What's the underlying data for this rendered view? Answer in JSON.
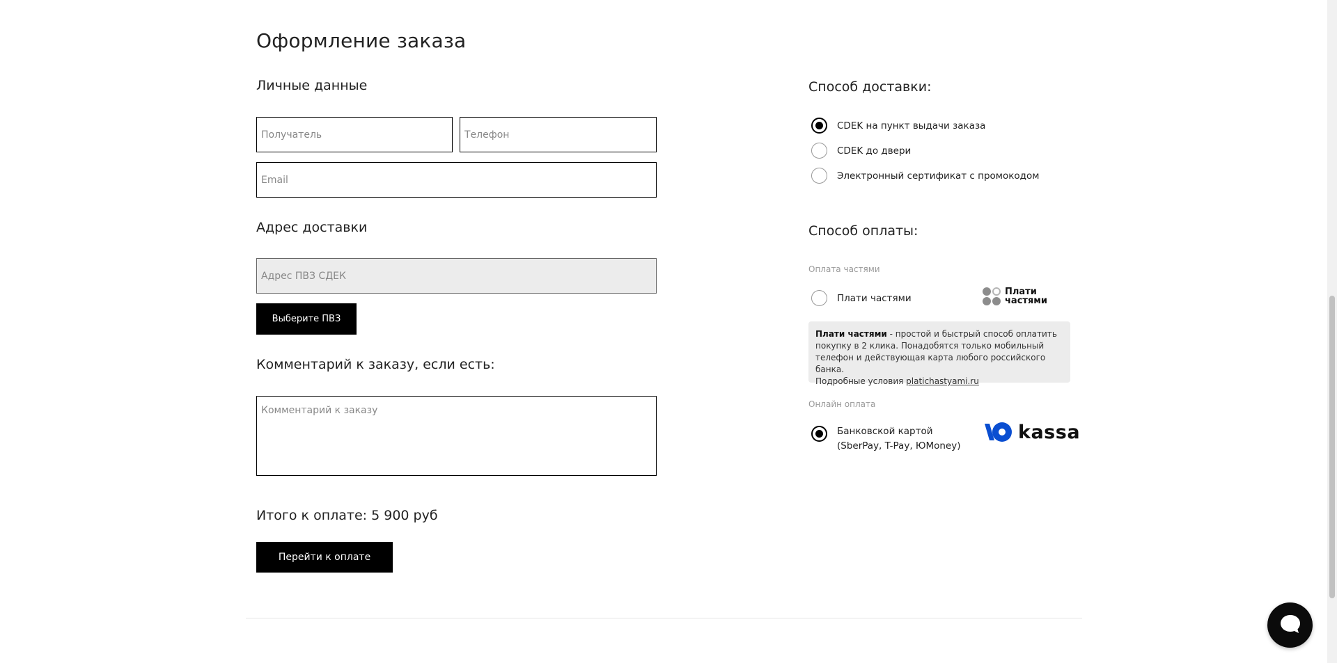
{
  "page": {
    "title": "Оформление заказа"
  },
  "personal": {
    "heading": "Личные данные",
    "recipient_placeholder": "Получатель",
    "phone_placeholder": "Телефон",
    "email_placeholder": "Email"
  },
  "address": {
    "heading": "Адрес доставки",
    "pvz_placeholder": "Адрес ПВЗ СДЕК",
    "select_pvz_label": "Выберите ПВЗ"
  },
  "comment": {
    "heading": "Комментарий к заказу, если есть:",
    "placeholder": "Комментарий к заказу"
  },
  "total": {
    "text": "Итого к оплате: 5 900 руб",
    "pay_button_label": "Перейти к оплате"
  },
  "delivery": {
    "heading": "Способ доставки:",
    "options": [
      {
        "label": "CDEK на пункт выдачи заказа",
        "selected": true
      },
      {
        "label": "CDEK до двери",
        "selected": false
      },
      {
        "label": "Электронный сертификат с промокодом",
        "selected": false
      }
    ]
  },
  "payment": {
    "heading": "Способ оплаты:",
    "installments_group_label": "Оплата частями",
    "installments_option": {
      "label": "Плати частями",
      "selected": false
    },
    "installments_logo_text": "Плати частями",
    "info": {
      "bold": "Плати частями",
      "text": " - простой и быстрый способ оплатить покупку в 2 клика. Понадобятся только мобильный телефон и действующая карта любого российского банка.",
      "terms_prefix": "Подробные условия ",
      "terms_link": "platichastyami.ru"
    },
    "online_group_label": "Онлайн оплата",
    "card_option": {
      "line1": "Банковской картой",
      "line2": "(SberPay, T-Pay, ЮMoney)",
      "selected": true
    },
    "kassa_logo_text": "kassa"
  },
  "colors": {
    "accent": "#000000",
    "disabled_field": "#ececec",
    "info_box": "#ececec"
  },
  "icons": {
    "chat": "chat-bubble-icon"
  }
}
